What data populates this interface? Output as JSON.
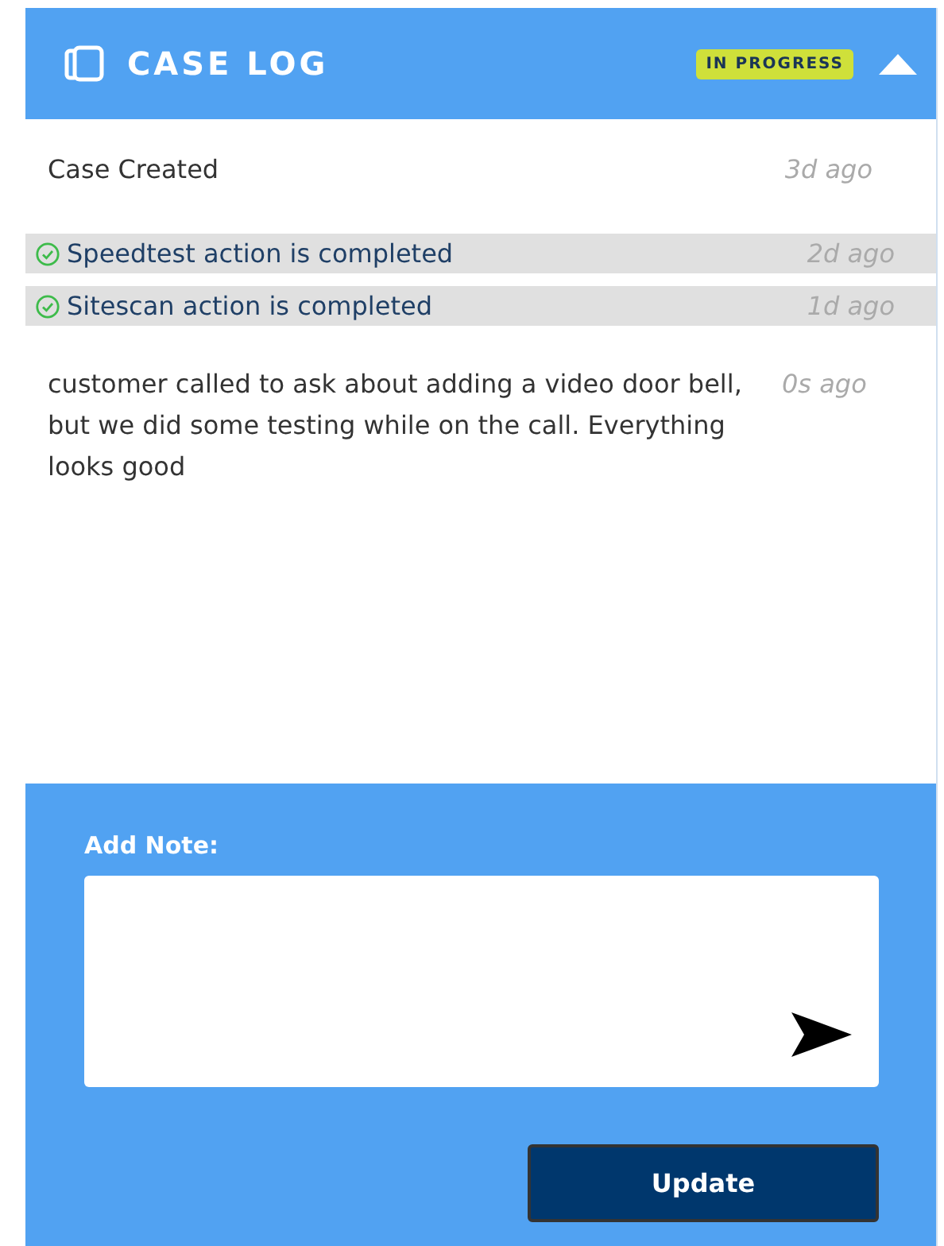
{
  "header": {
    "title": "CASE LOG",
    "status": "IN PROGRESS",
    "expanded": true
  },
  "entries": [
    {
      "kind": "event",
      "text": "Case Created",
      "time": "3d ago"
    },
    {
      "kind": "action",
      "completed": true,
      "text": "Speedtest action is completed",
      "time": "2d ago"
    },
    {
      "kind": "action",
      "completed": true,
      "text": "Sitescan action is completed",
      "time": "1d ago"
    },
    {
      "kind": "note",
      "text": "customer called to ask about adding a video door bell, but we did some testing while on the call. Everything looks good",
      "time": "0s ago"
    }
  ],
  "note_form": {
    "label": "Add Note:",
    "button": "Update"
  }
}
